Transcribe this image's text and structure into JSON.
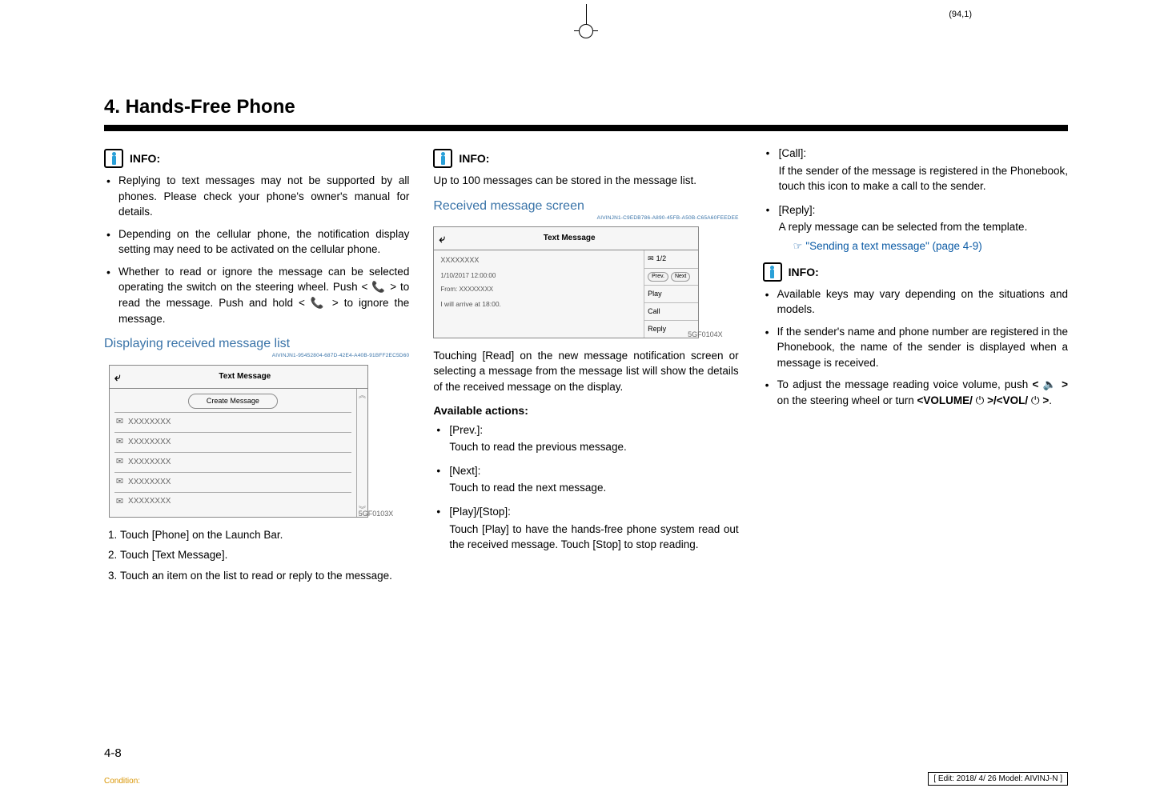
{
  "top_marker": "(94,1)",
  "chapter": "4. Hands-Free Phone",
  "info_label": "INFO:",
  "col1": {
    "bullets": [
      "Replying to text messages may not be supported by all phones. Please check your phone's owner's manual for details.",
      "Depending on the cellular phone, the notification display setting may need to be activated on the cellular phone.",
      "Whether to read or ignore the message can be selected operating the switch on the steering wheel. Push <  📞  > to read the message. Push and hold <  📞  > to ignore the message."
    ],
    "heading": "Displaying received message list",
    "guid": "AIVINJN1-95452804-687D-42E4-A40B-91BFF2EC5D60",
    "fig": {
      "title": "Text Message",
      "create": "Create Message",
      "rows": [
        "XXXXXXXX",
        "XXXXXXXX",
        "XXXXXXXX",
        "XXXXXXXX",
        "XXXXXXXX"
      ],
      "code": "5GF0103X"
    },
    "steps": [
      "Touch [Phone] on the Launch Bar.",
      "Touch [Text Message].",
      "Touch an item on the list to read or reply to the message."
    ]
  },
  "col2": {
    "intro": "Up to 100 messages can be stored in the message list.",
    "heading": "Received message screen",
    "guid": "AIVINJN1-C9EDB786-A890-45FB-A50B-C65A60FEEDEE",
    "fig": {
      "title": "Text Message",
      "sender": "XXXXXXXX",
      "datetime": "1/10/2017  12:00:00",
      "from": "From: XXXXXXXX",
      "body": "I will arrive at 18:00.",
      "counter": "1/2",
      "prev": "Prev.",
      "next": "Next",
      "play": "Play",
      "call": "Call",
      "reply": "Reply",
      "code": "5GF0104X"
    },
    "para": "Touching [Read] on the new message notification screen or selecting a message from the message list will show the details of the received message on the display.",
    "actions_title": "Available actions:",
    "actions": [
      {
        "label": "[Prev.]:",
        "desc": "Touch to read the previous message."
      },
      {
        "label": "[Next]:",
        "desc": "Touch to read the next message."
      },
      {
        "label": "[Play]/[Stop]:",
        "desc": "Touch [Play] to have the hands-free phone system read out the received message. Touch [Stop] to stop reading."
      }
    ]
  },
  "col3": {
    "actions_cont": [
      {
        "label": "[Call]:",
        "desc": "If the sender of the message is registered in the Phonebook, touch this icon to make a call to the sender."
      },
      {
        "label": "[Reply]:",
        "desc": "A reply message can be selected from the template."
      }
    ],
    "link_text": "\"Sending a text message\" (page 4-9)",
    "info_bullets": [
      "Available keys may vary depending on the situations and models.",
      "If the sender's name and phone number are registered in the Phonebook, the name of the sender is displayed when a message is received.",
      "To adjust the message reading voice volume, push < 🔈 > on the steering wheel or turn <VOLUME/ ⏻ >/<VOL/ ⏻ >."
    ]
  },
  "page_number": "4-8",
  "footer_left": "Condition:",
  "footer_right": "[ Edit: 2018/ 4/ 26    Model:  AIVINJ-N ]"
}
